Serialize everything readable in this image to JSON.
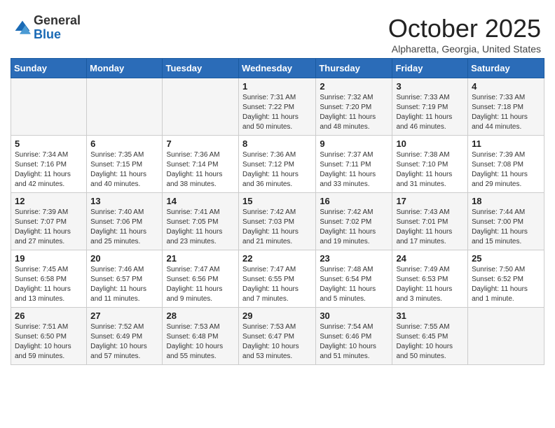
{
  "header": {
    "logo_general": "General",
    "logo_blue": "Blue",
    "month": "October 2025",
    "location": "Alpharetta, Georgia, United States"
  },
  "weekdays": [
    "Sunday",
    "Monday",
    "Tuesday",
    "Wednesday",
    "Thursday",
    "Friday",
    "Saturday"
  ],
  "weeks": [
    [
      {
        "day": "",
        "info": ""
      },
      {
        "day": "",
        "info": ""
      },
      {
        "day": "",
        "info": ""
      },
      {
        "day": "1",
        "info": "Sunrise: 7:31 AM\nSunset: 7:22 PM\nDaylight: 11 hours\nand 50 minutes."
      },
      {
        "day": "2",
        "info": "Sunrise: 7:32 AM\nSunset: 7:20 PM\nDaylight: 11 hours\nand 48 minutes."
      },
      {
        "day": "3",
        "info": "Sunrise: 7:33 AM\nSunset: 7:19 PM\nDaylight: 11 hours\nand 46 minutes."
      },
      {
        "day": "4",
        "info": "Sunrise: 7:33 AM\nSunset: 7:18 PM\nDaylight: 11 hours\nand 44 minutes."
      }
    ],
    [
      {
        "day": "5",
        "info": "Sunrise: 7:34 AM\nSunset: 7:16 PM\nDaylight: 11 hours\nand 42 minutes."
      },
      {
        "day": "6",
        "info": "Sunrise: 7:35 AM\nSunset: 7:15 PM\nDaylight: 11 hours\nand 40 minutes."
      },
      {
        "day": "7",
        "info": "Sunrise: 7:36 AM\nSunset: 7:14 PM\nDaylight: 11 hours\nand 38 minutes."
      },
      {
        "day": "8",
        "info": "Sunrise: 7:36 AM\nSunset: 7:12 PM\nDaylight: 11 hours\nand 36 minutes."
      },
      {
        "day": "9",
        "info": "Sunrise: 7:37 AM\nSunset: 7:11 PM\nDaylight: 11 hours\nand 33 minutes."
      },
      {
        "day": "10",
        "info": "Sunrise: 7:38 AM\nSunset: 7:10 PM\nDaylight: 11 hours\nand 31 minutes."
      },
      {
        "day": "11",
        "info": "Sunrise: 7:39 AM\nSunset: 7:08 PM\nDaylight: 11 hours\nand 29 minutes."
      }
    ],
    [
      {
        "day": "12",
        "info": "Sunrise: 7:39 AM\nSunset: 7:07 PM\nDaylight: 11 hours\nand 27 minutes."
      },
      {
        "day": "13",
        "info": "Sunrise: 7:40 AM\nSunset: 7:06 PM\nDaylight: 11 hours\nand 25 minutes."
      },
      {
        "day": "14",
        "info": "Sunrise: 7:41 AM\nSunset: 7:05 PM\nDaylight: 11 hours\nand 23 minutes."
      },
      {
        "day": "15",
        "info": "Sunrise: 7:42 AM\nSunset: 7:03 PM\nDaylight: 11 hours\nand 21 minutes."
      },
      {
        "day": "16",
        "info": "Sunrise: 7:42 AM\nSunset: 7:02 PM\nDaylight: 11 hours\nand 19 minutes."
      },
      {
        "day": "17",
        "info": "Sunrise: 7:43 AM\nSunset: 7:01 PM\nDaylight: 11 hours\nand 17 minutes."
      },
      {
        "day": "18",
        "info": "Sunrise: 7:44 AM\nSunset: 7:00 PM\nDaylight: 11 hours\nand 15 minutes."
      }
    ],
    [
      {
        "day": "19",
        "info": "Sunrise: 7:45 AM\nSunset: 6:58 PM\nDaylight: 11 hours\nand 13 minutes."
      },
      {
        "day": "20",
        "info": "Sunrise: 7:46 AM\nSunset: 6:57 PM\nDaylight: 11 hours\nand 11 minutes."
      },
      {
        "day": "21",
        "info": "Sunrise: 7:47 AM\nSunset: 6:56 PM\nDaylight: 11 hours\nand 9 minutes."
      },
      {
        "day": "22",
        "info": "Sunrise: 7:47 AM\nSunset: 6:55 PM\nDaylight: 11 hours\nand 7 minutes."
      },
      {
        "day": "23",
        "info": "Sunrise: 7:48 AM\nSunset: 6:54 PM\nDaylight: 11 hours\nand 5 minutes."
      },
      {
        "day": "24",
        "info": "Sunrise: 7:49 AM\nSunset: 6:53 PM\nDaylight: 11 hours\nand 3 minutes."
      },
      {
        "day": "25",
        "info": "Sunrise: 7:50 AM\nSunset: 6:52 PM\nDaylight: 11 hours\nand 1 minute."
      }
    ],
    [
      {
        "day": "26",
        "info": "Sunrise: 7:51 AM\nSunset: 6:50 PM\nDaylight: 10 hours\nand 59 minutes."
      },
      {
        "day": "27",
        "info": "Sunrise: 7:52 AM\nSunset: 6:49 PM\nDaylight: 10 hours\nand 57 minutes."
      },
      {
        "day": "28",
        "info": "Sunrise: 7:53 AM\nSunset: 6:48 PM\nDaylight: 10 hours\nand 55 minutes."
      },
      {
        "day": "29",
        "info": "Sunrise: 7:53 AM\nSunset: 6:47 PM\nDaylight: 10 hours\nand 53 minutes."
      },
      {
        "day": "30",
        "info": "Sunrise: 7:54 AM\nSunset: 6:46 PM\nDaylight: 10 hours\nand 51 minutes."
      },
      {
        "day": "31",
        "info": "Sunrise: 7:55 AM\nSunset: 6:45 PM\nDaylight: 10 hours\nand 50 minutes."
      },
      {
        "day": "",
        "info": ""
      }
    ]
  ]
}
